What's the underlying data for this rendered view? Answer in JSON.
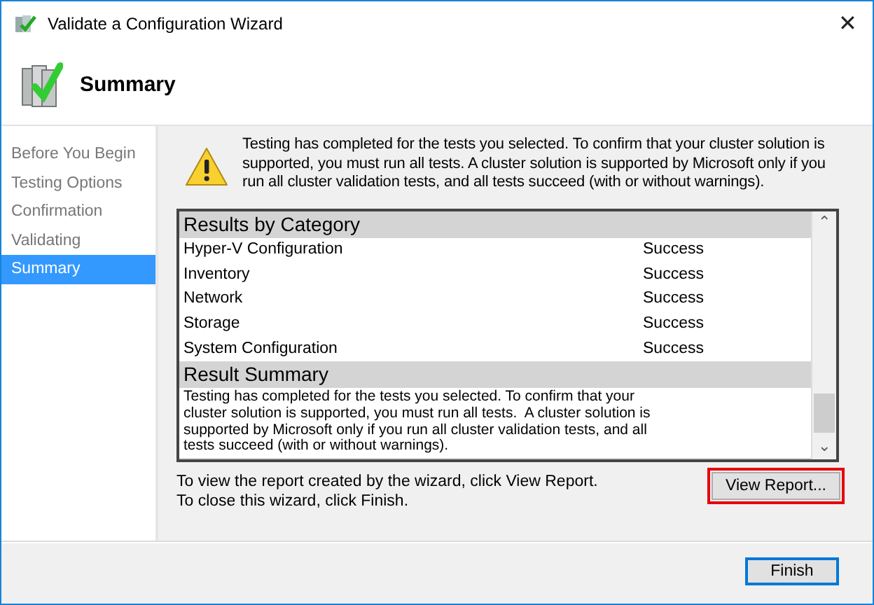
{
  "window": {
    "title": "Validate a Configuration Wizard",
    "close": "✕"
  },
  "header": {
    "title": "Summary"
  },
  "steps": [
    {
      "label": "Before You Begin",
      "selected": false
    },
    {
      "label": "Testing Options",
      "selected": false
    },
    {
      "label": "Confirmation",
      "selected": false
    },
    {
      "label": "Validating",
      "selected": false
    },
    {
      "label": "Summary",
      "selected": true
    }
  ],
  "warning": "Testing has completed for the tests you selected. To confirm that your cluster solution is supported, you must run all tests.  A cluster solution is supported by Microsoft only if you run all cluster validation tests, and all tests succeed (with or without warnings).",
  "report": {
    "sections": [
      {
        "kind": "table",
        "title": "Results by Category",
        "rows": [
          {
            "name": "Hyper-V Configuration",
            "status": "Success"
          },
          {
            "name": "Inventory",
            "status": "Success"
          },
          {
            "name": "Network",
            "status": "Success"
          },
          {
            "name": "Storage",
            "status": "Success"
          },
          {
            "name": "System Configuration",
            "status": "Success"
          }
        ]
      },
      {
        "kind": "text",
        "title": "Result Summary",
        "text": "Testing has completed for the tests you selected. To confirm that your cluster solution is supported, you must run all tests.  A cluster solution is supported by Microsoft only if you run all cluster validation tests, and all tests succeed (with or without warnings)."
      }
    ],
    "scroll_up": "⌃",
    "scroll_down": "⌄"
  },
  "instructions": [
    "To view the report created by the wizard, click View Report.",
    "To close this wizard, click Finish."
  ],
  "view_report": {
    "label": "View Report...",
    "highlighted": true
  },
  "buttons": [
    {
      "label": "Finish",
      "default": true
    }
  ]
}
